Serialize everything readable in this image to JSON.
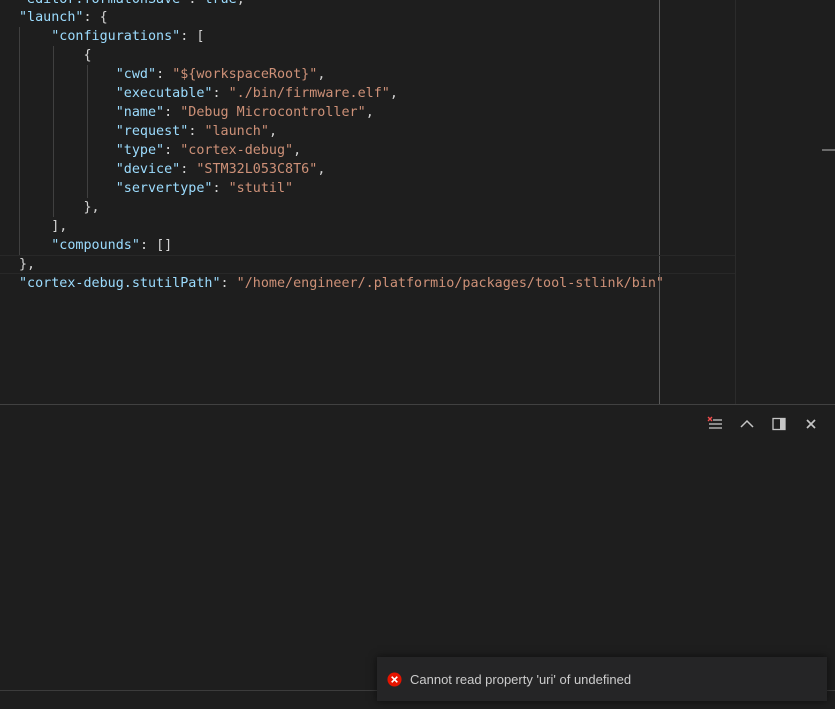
{
  "editor": {
    "lines": [
      {
        "indent": "",
        "key": "\"editor.formatOnSave\"",
        "sep": ": ",
        "value": "true",
        "tail": ","
      },
      {
        "indent": "",
        "key": "\"launch\"",
        "sep": ": ",
        "value": "",
        "tail": "{"
      },
      {
        "indent": "    ",
        "key": "\"configurations\"",
        "sep": ": ",
        "value": "",
        "tail": "["
      },
      {
        "indent": "        ",
        "key": "",
        "sep": "",
        "value": "",
        "tail": "{"
      },
      {
        "indent": "            ",
        "key": "\"cwd\"",
        "sep": ": ",
        "value": "\"${workspaceRoot}\"",
        "tail": ","
      },
      {
        "indent": "            ",
        "key": "\"executable\"",
        "sep": ": ",
        "value": "\"./bin/firmware.elf\"",
        "tail": ","
      },
      {
        "indent": "            ",
        "key": "\"name\"",
        "sep": ": ",
        "value": "\"Debug Microcontroller\"",
        "tail": ","
      },
      {
        "indent": "            ",
        "key": "\"request\"",
        "sep": ": ",
        "value": "\"launch\"",
        "tail": ","
      },
      {
        "indent": "            ",
        "key": "\"type\"",
        "sep": ": ",
        "value": "\"cortex-debug\"",
        "tail": ","
      },
      {
        "indent": "            ",
        "key": "\"device\"",
        "sep": ": ",
        "value": "\"STM32L053C8T6\"",
        "tail": ","
      },
      {
        "indent": "            ",
        "key": "\"servertype\"",
        "sep": ": ",
        "value": "\"stutil\"",
        "tail": ""
      },
      {
        "indent": "        ",
        "key": "",
        "sep": "",
        "value": "",
        "tail": "},"
      },
      {
        "indent": "    ",
        "key": "",
        "sep": "",
        "value": "",
        "tail": "],"
      },
      {
        "indent": "    ",
        "key": "\"compounds\"",
        "sep": ": ",
        "value": "",
        "tail": "[]"
      },
      {
        "indent": "",
        "key": "",
        "sep": "",
        "value": "",
        "tail": "},"
      },
      {
        "indent": "",
        "key": "\"cortex-debug.stutilPath\"",
        "sep": ": ",
        "value": "\"/home/engineer/.platformio/packages/tool-stlink/bin\"",
        "tail": ""
      }
    ]
  },
  "panel": {
    "actions": [
      {
        "name": "clear-console-icon"
      },
      {
        "name": "maximize-panel-icon"
      },
      {
        "name": "toggle-panel-position-icon"
      },
      {
        "name": "close-panel-icon"
      }
    ]
  },
  "notification": {
    "icon": "error-icon",
    "message": "Cannot read property 'uri' of undefined",
    "color": "#e51400"
  }
}
